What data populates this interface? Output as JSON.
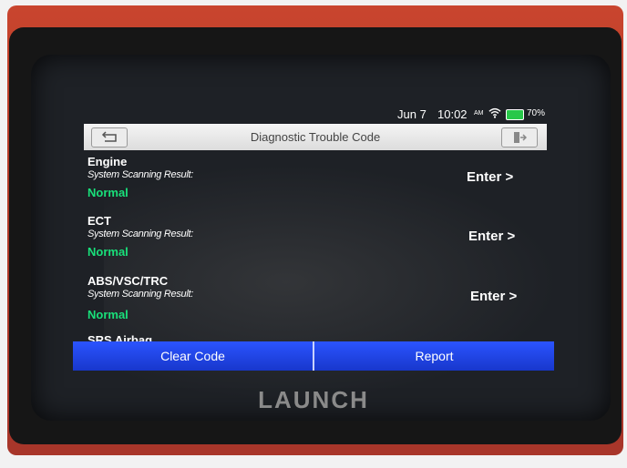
{
  "status_bar": {
    "date": "Jun 7",
    "time": "10:02",
    "ampm": "AM",
    "battery": "70%"
  },
  "header": {
    "title": "Diagnostic Trouble Code"
  },
  "systems": [
    {
      "name": "Engine",
      "label": "System Scanning Result:",
      "status": "Normal",
      "action": "Enter >"
    },
    {
      "name": "ECT",
      "label": "System Scanning Result:",
      "status": "Normal",
      "action": "Enter >"
    },
    {
      "name": "ABS/VSC/TRC",
      "label": "System Scanning Result:",
      "status": "Normal",
      "action": "Enter >"
    },
    {
      "name": "SRS Airbag"
    }
  ],
  "actions": {
    "clear_code": "Clear Code",
    "report": "Report"
  },
  "brand": "LAUNCH",
  "colors": {
    "status_normal": "#19e07a",
    "button_blue": "#2b54ff",
    "device_case": "#c9452e"
  },
  "icons": [
    "back-arrow-icon",
    "exit-icon",
    "wifi-icon",
    "battery-icon"
  ]
}
